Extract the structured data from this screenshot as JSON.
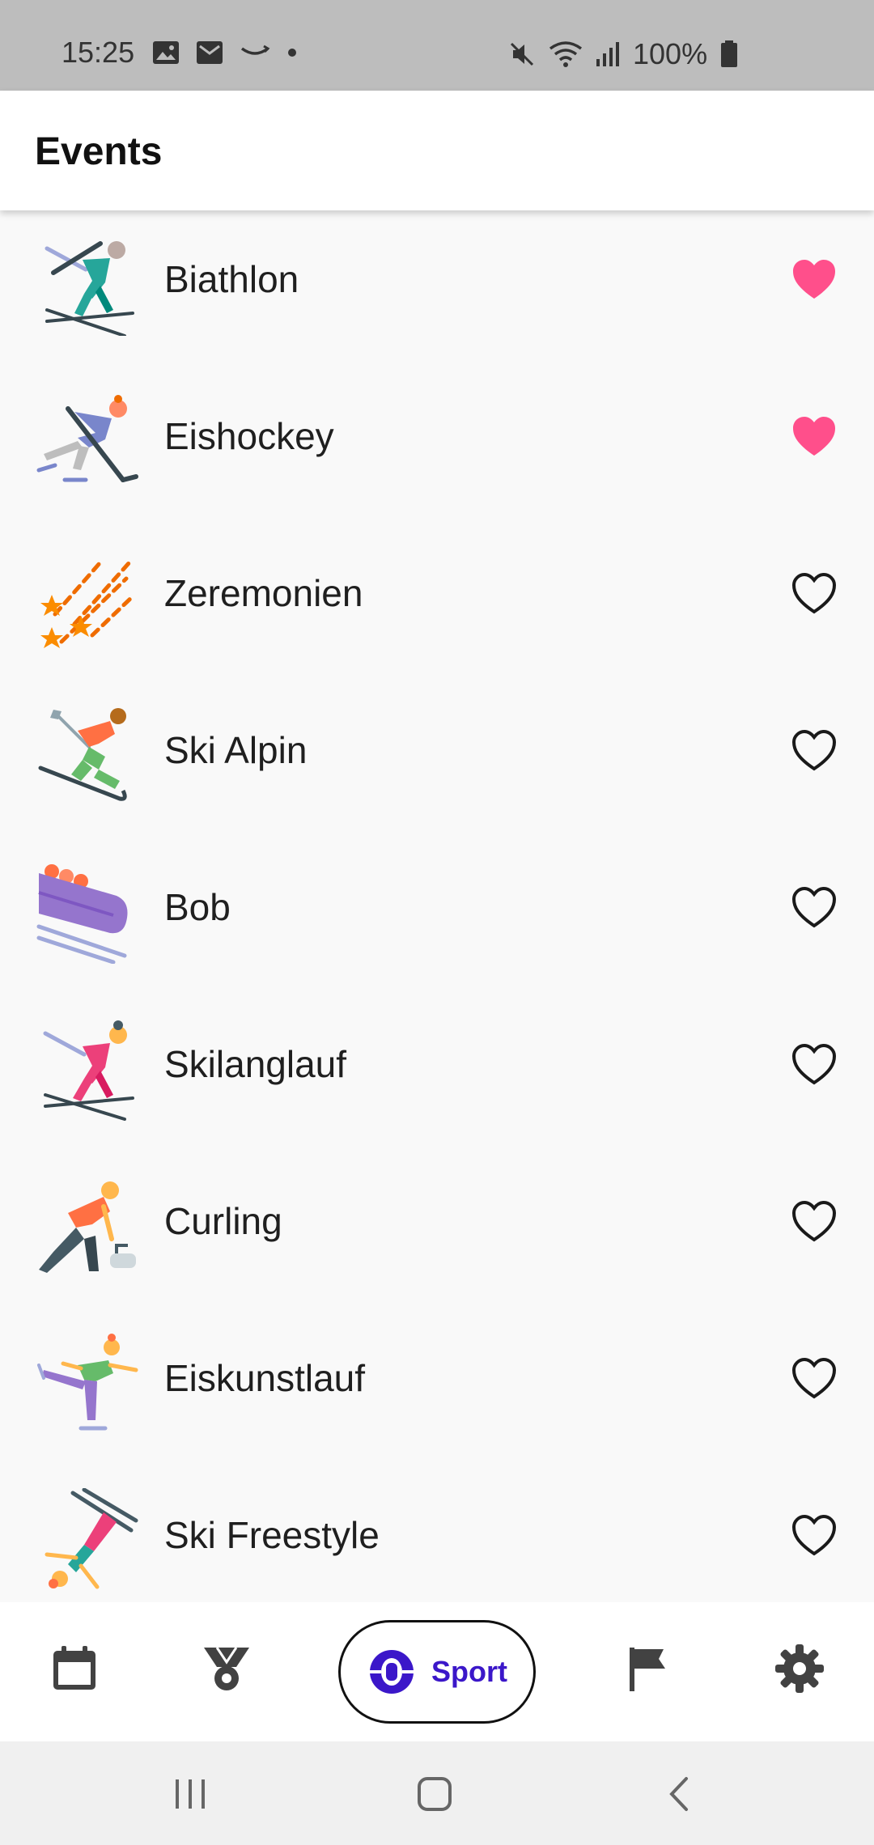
{
  "status_bar": {
    "time": "15:25",
    "battery": "100%",
    "left_icons": [
      "image-icon",
      "mail-icon",
      "amazon-icon",
      "dot-icon"
    ],
    "right_icons": [
      "mute-icon",
      "wifi-icon",
      "signal-icon",
      "battery-icon"
    ]
  },
  "appbar": {
    "title": "Events"
  },
  "events": [
    {
      "name": "Biathlon",
      "icon": "biathlon-icon",
      "favorite": true
    },
    {
      "name": "Eishockey",
      "icon": "ice-hockey-icon",
      "favorite": true
    },
    {
      "name": "Zeremonien",
      "icon": "ceremony-icon",
      "favorite": false
    },
    {
      "name": "Ski Alpin",
      "icon": "alpine-ski-icon",
      "favorite": false
    },
    {
      "name": "Bob",
      "icon": "bobsleigh-icon",
      "favorite": false
    },
    {
      "name": "Skilanglauf",
      "icon": "cross-country-ski-icon",
      "favorite": false
    },
    {
      "name": "Curling",
      "icon": "curling-icon",
      "favorite": false
    },
    {
      "name": "Eiskunstlauf",
      "icon": "figure-skating-icon",
      "favorite": false
    },
    {
      "name": "Ski Freestyle",
      "icon": "freestyle-ski-icon",
      "favorite": false
    }
  ],
  "bottom_nav": {
    "active_label": "Sport",
    "items": [
      "calendar-icon",
      "medal-icon",
      "sport-icon",
      "flag-icon",
      "settings-icon"
    ]
  },
  "colors": {
    "favorite": "#ff4f8b",
    "accent": "#3b17c9",
    "status_bar": "#bdbdbd"
  }
}
